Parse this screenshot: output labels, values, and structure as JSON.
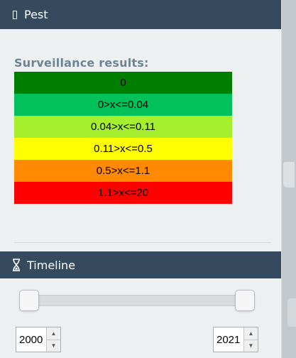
{
  "pest_panel": {
    "title": "Pest",
    "icon": "bug-icon"
  },
  "legend": {
    "title": "Surveillance results:",
    "items": [
      {
        "label": "0",
        "color": "#007e00"
      },
      {
        "label": "0>x<=0.04",
        "color": "#00c15a"
      },
      {
        "label": "0.04>x<=0.11",
        "color": "#a6ef2d"
      },
      {
        "label": "0.11>x<=0.5",
        "color": "#ffff00"
      },
      {
        "label": "0.5>x<=1.1",
        "color": "#ff8900"
      },
      {
        "label": "1.1>x<=20",
        "color": "#ff0000"
      }
    ]
  },
  "timeline": {
    "title": "Timeline",
    "icon": "hourglass-icon",
    "start_year": "2000",
    "end_year": "2021",
    "range_fraction": [
      0.0,
      1.0
    ]
  },
  "colors": {
    "header_bg": "#354a5f",
    "panel_bg": "#ecf0f1",
    "legend_title": "#6d8497"
  }
}
